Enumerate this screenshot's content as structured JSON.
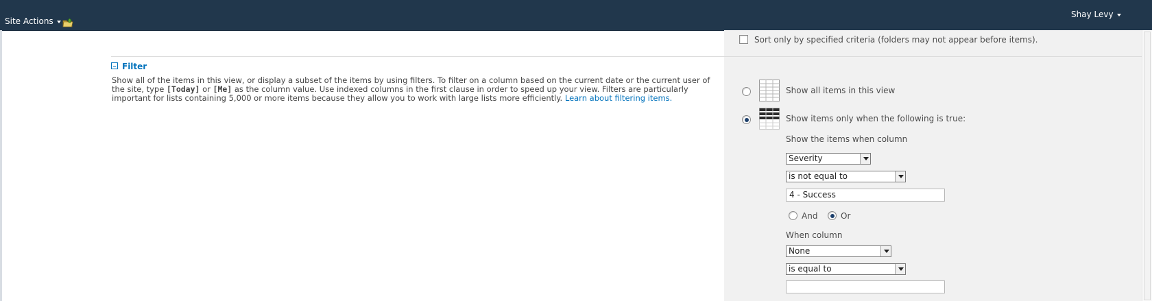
{
  "topbar": {
    "site_actions_label": "Site Actions",
    "user_name": "Shay Levy",
    "background_color": "#21374c"
  },
  "sort": {
    "checkbox_label": "Sort only by specified criteria (folders may not appear before items).",
    "checked": false
  },
  "filter_section": {
    "title": "Filter",
    "description_part1": "Show all of the items in this view, or display a subset of the items by using filters. To filter on a column based on the current date or the current user of the site, type ",
    "today_token": "[Today]",
    "description_or": " or ",
    "me_token": "[Me]",
    "description_part2": " as the column value. Use indexed columns in the first clause in order to speed up your view. Filters are particularly important for lists containing 5,000 or more items because they allow you to work with large lists more efficiently. ",
    "learn_link": "Learn about filtering items."
  },
  "options": {
    "show_all_label": "Show all items in this view",
    "show_when_label": "Show items only when the following is true:",
    "selected": "show_when"
  },
  "clause1": {
    "column_label": "Show the items when column",
    "column_value": "Severity",
    "operator_value": "is not equal to",
    "value_text": "4 - Success"
  },
  "logic": {
    "and_label": "And",
    "or_label": "Or",
    "selected": "Or"
  },
  "clause2": {
    "column_label": "When column",
    "column_value": "None",
    "operator_value": "is equal to",
    "value_text": ""
  },
  "colors": {
    "link": "#0072bc",
    "panel": "#f1f1f1"
  }
}
